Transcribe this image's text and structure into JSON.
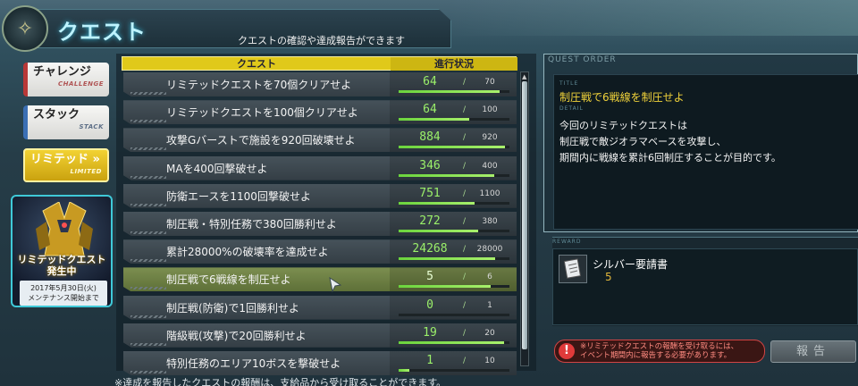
{
  "header": {
    "title": "クエスト",
    "subtitle": "クエストの確認や達成報告ができます"
  },
  "sidebar": {
    "challenge": {
      "jp": "チャレンジ",
      "en": "CHALLENGE"
    },
    "stack": {
      "jp": "スタック",
      "en": "STACK"
    },
    "limited": {
      "jp": "リミテッド",
      "en": "LIMITED"
    }
  },
  "promo": {
    "title": "リミテッドクエスト\n発生中",
    "date": "2017年5月30日(火)\nメンテナンス開始まで"
  },
  "table": {
    "col_quest": "クエスト",
    "col_progress": "進行状況",
    "rows": [
      {
        "name": "リミテッドクエストを70個クリアせよ",
        "current": "64",
        "max": "70",
        "progress": 0.914
      },
      {
        "name": "リミテッドクエストを100個クリアせよ",
        "current": "64",
        "max": "100",
        "progress": 0.64
      },
      {
        "name": "攻撃Gバーストで施設を920回破壊せよ",
        "current": "884",
        "max": "920",
        "progress": 0.961
      },
      {
        "name": "MAを400回撃破せよ",
        "current": "346",
        "max": "400",
        "progress": 0.865
      },
      {
        "name": "防衛エースを1100回撃破せよ",
        "current": "751",
        "max": "1100",
        "progress": 0.683
      },
      {
        "name": "制圧戦・特別任務で380回勝利せよ",
        "current": "272",
        "max": "380",
        "progress": 0.716
      },
      {
        "name": "累計28000%の破壊率を達成せよ",
        "current": "24268",
        "max": "28000",
        "progress": 0.867
      },
      {
        "name": "制圧戦で6戦線を制圧せよ",
        "current": "5",
        "max": "6",
        "progress": 0.833
      },
      {
        "name": "制圧戦(防衛)で1回勝利せよ",
        "current": "0",
        "max": "1",
        "progress": 0
      },
      {
        "name": "階級戦(攻撃)で20回勝利せよ",
        "current": "19",
        "max": "20",
        "progress": 0.95
      },
      {
        "name": "特別任務のエリア10ボスを撃破せよ",
        "current": "1",
        "max": "10",
        "progress": 0.1
      }
    ],
    "selected_index": 7
  },
  "footer_note": "※達成を報告したクエストの報酬は、支給品から受け取ることができます。",
  "order": {
    "label": "QUEST ORDER",
    "title_label": "TITLE",
    "title": "制圧戦で6戦線を制圧せよ",
    "detail_label": "DETAIL",
    "detail": "今回のリミテッドクエストは\n制圧戦で敵ジオラマベースを攻撃し、\n期間内に戦線を累計6回制圧することが目的です。",
    "reward_label": "REWARD",
    "reward_name": "シルバー要請書",
    "reward_qty": "5",
    "warning": "※リミテッドクエストの報酬を受け取るには、\nイベント期間内に報告する必要があります。",
    "report_button": "報告"
  },
  "colors": {
    "accent": "#e0c91a",
    "progress": "#7ee04a",
    "title_glow": "#38c6e8",
    "warning": "#e03a3a"
  },
  "icons": {
    "emblem": "compass-emblem-icon",
    "warning": "exclamation-icon",
    "reward": "document-icon",
    "cursor": "pointer-cursor-icon"
  }
}
